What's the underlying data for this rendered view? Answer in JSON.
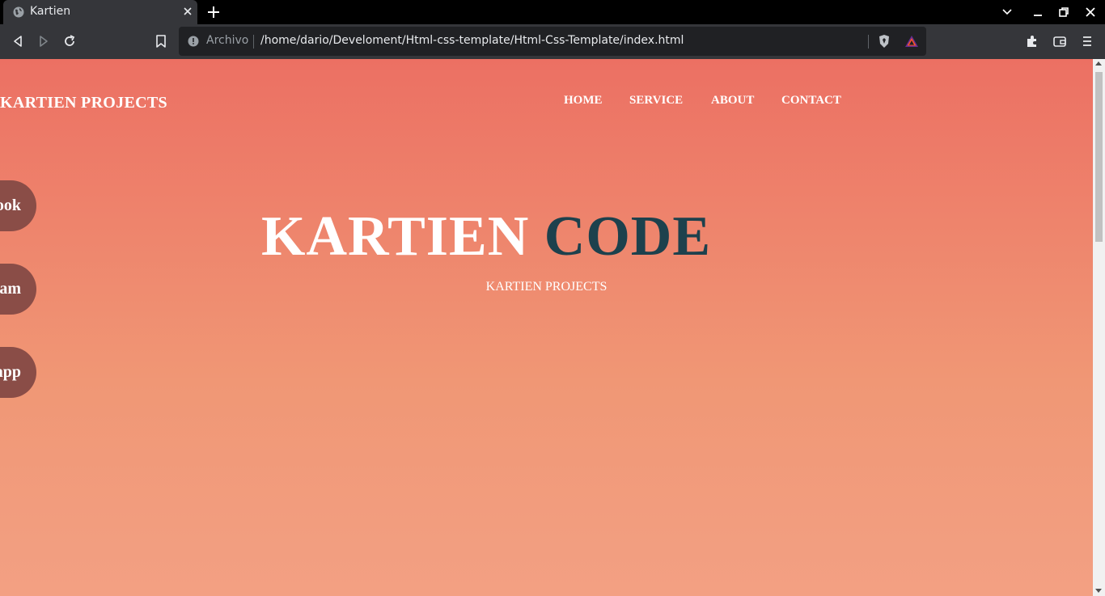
{
  "browser": {
    "tab": {
      "title": "Kartien",
      "favicon": "globe-icon"
    },
    "toolbar": {
      "security_label": "Archivo",
      "url": "/home/dario/Develoment/Html-css-template/Html-Css-Template/index.html"
    }
  },
  "page": {
    "brand": "KARTIEN PROJECTS",
    "nav": [
      "HOME",
      "SERVICE",
      "ABOUT",
      "CONTACT"
    ],
    "social": [
      "ook",
      "am",
      "app"
    ],
    "hero": {
      "title_main": "KARTIEN",
      "title_accent": "CODE",
      "subtitle": "KARTIEN PROJECTS"
    },
    "colors": {
      "gradient_top": "#ec7063",
      "gradient_bottom": "#f3a083",
      "accent": "#1d414d",
      "social_bg": "#8a4d47"
    }
  }
}
